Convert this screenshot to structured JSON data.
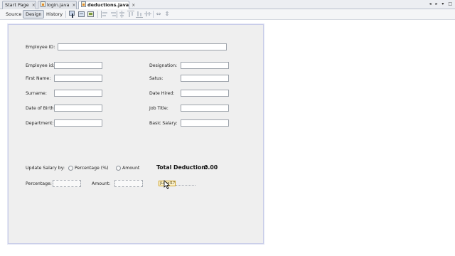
{
  "tabs": [
    {
      "label": "Start Page",
      "close": "×",
      "active": false
    },
    {
      "label": "login.java",
      "close": "×",
      "active": false
    },
    {
      "label": "deductions.java",
      "close": "×",
      "active": true
    }
  ],
  "tab_scroll": "◂ ▸ ▾ □",
  "toolbar": {
    "views": [
      "Source",
      "Design",
      "History"
    ],
    "active_view": "Design"
  },
  "form": {
    "employee_id_top": "Employee ID:",
    "left_labels": [
      "Employee id:",
      "First Name:",
      "Surname:",
      "Date of Birth:",
      "Department:"
    ],
    "right_labels": [
      "Designation:",
      "Satus:",
      "Date Hired:",
      "Job Title:",
      "Basic Salary:"
    ],
    "update_salary_by": "Update Salary by:",
    "radio_percentage": "Percentage (%)",
    "radio_amount": "Amount",
    "total_deduction_label": "Total Deduction:",
    "total_deduction_value": "0.00",
    "percentage_label": "Percentage:",
    "amount_label": "Amount:",
    "selected_widget_text": "jLabel17"
  }
}
